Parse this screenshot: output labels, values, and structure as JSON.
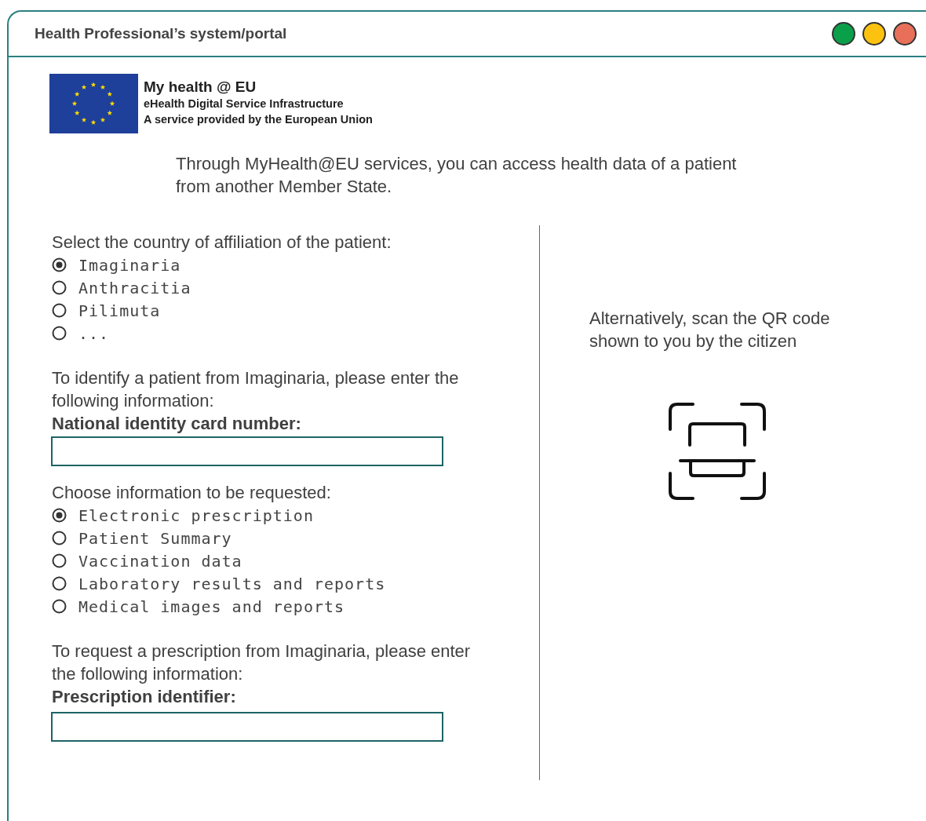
{
  "window": {
    "title": "Health Professional’s system/portal",
    "controls": [
      {
        "color": "#0aa04a"
      },
      {
        "color": "#fcc20f"
      },
      {
        "color": "#e8705a"
      }
    ]
  },
  "logo": {
    "title": "My health @ EU",
    "subtitle": "eHealth Digital Service Infrastructure",
    "tagline": "A service provided by the European Union"
  },
  "intro": "Through MyHealth@EU services, you can access health data of a patient from another Member State.",
  "country": {
    "prompt": "Select the country of affiliation of the patient:",
    "options": [
      {
        "label": "Imaginaria",
        "selected": true
      },
      {
        "label": "Anthracitia",
        "selected": false
      },
      {
        "label": "Pilimuta",
        "selected": false
      },
      {
        "label": "...",
        "selected": false
      }
    ]
  },
  "identify": {
    "text": "To identify a patient from Imaginaria, please enter the following information:",
    "field_label": "National identity card number:"
  },
  "information": {
    "prompt": "Choose information to be requested:",
    "options": [
      {
        "label": "Electronic prescription",
        "selected": true
      },
      {
        "label": "Patient Summary",
        "selected": false
      },
      {
        "label": "Vaccination data",
        "selected": false
      },
      {
        "label": "Laboratory results and reports",
        "selected": false
      },
      {
        "label": "Medical images and reports",
        "selected": false
      }
    ]
  },
  "prescription": {
    "text": "To request a prescription from Imaginaria, please enter the following information:",
    "field_label": "Prescription identifier:"
  },
  "scan": {
    "text": "Alternatively, scan the QR code shown to you by the citizen"
  }
}
